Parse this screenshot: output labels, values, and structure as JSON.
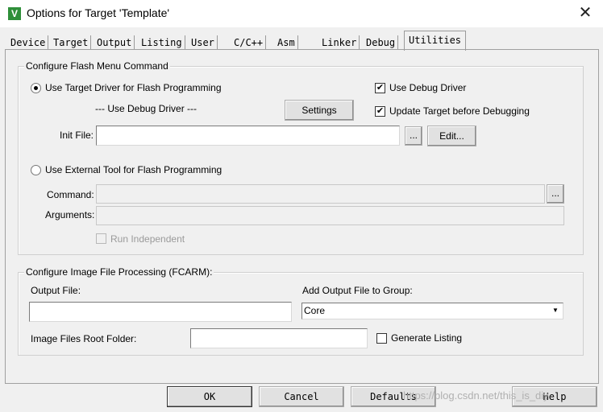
{
  "window": {
    "title": "Options for Target 'Template'"
  },
  "tabs": [
    "Device",
    "Target",
    "Output",
    "Listing",
    "User",
    "C/C++",
    "Asm",
    "Linker",
    "Debug",
    "Utilities"
  ],
  "flash": {
    "group_label": "Configure Flash Menu Command",
    "use_target_label": "Use Target Driver for Flash Programming",
    "driver_select": "--- Use Debug Driver ---",
    "settings_label": "Settings",
    "use_debug_driver_label": "Use Debug Driver",
    "update_target_label": "Update Target before Debugging",
    "init_file_label": "Init File:",
    "init_file_value": "",
    "browse_label": "...",
    "edit_label": "Edit...",
    "use_external_label": "Use External Tool for Flash Programming",
    "command_label": "Command:",
    "command_browse_label": "...",
    "arguments_label": "Arguments:",
    "run_independent_label": "Run Independent"
  },
  "image": {
    "group_label": "Configure Image File Processing (FCARM):",
    "output_file_label": "Output File:",
    "output_file_value": "",
    "add_output_label": "Add Output File  to Group:",
    "group_select_value": "Core",
    "root_folder_label": "Image Files Root Folder:",
    "root_folder_value": "",
    "generate_listing_label": "Generate Listing"
  },
  "buttons": {
    "ok": "OK",
    "cancel": "Cancel",
    "defaults": "Defaults",
    "help": "Help"
  },
  "watermark": "https://blog.csdn.net/this_is_diy"
}
